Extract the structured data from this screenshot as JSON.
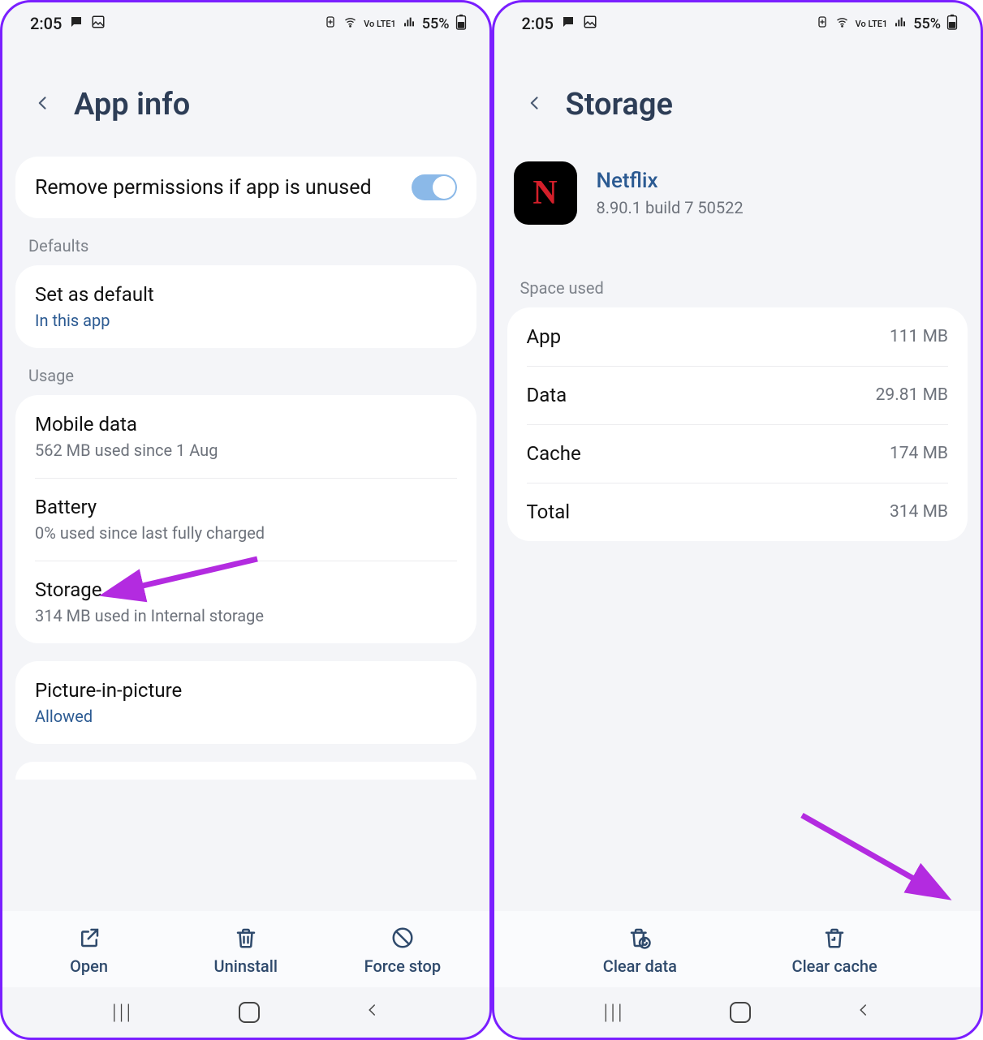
{
  "status": {
    "time": "2:05",
    "battery_pct": "55%",
    "net_label": "Vo LTE1"
  },
  "left": {
    "title": "App info",
    "permission_row": {
      "title": "Remove permissions if app is unused"
    },
    "sections": {
      "defaults_label": "Defaults",
      "usage_label": "Usage"
    },
    "default_row": {
      "title": "Set as default",
      "sub": "In this app"
    },
    "usage": {
      "mobile": {
        "title": "Mobile data",
        "sub": "562 MB used since 1 Aug"
      },
      "battery": {
        "title": "Battery",
        "sub": "0% used since last fully charged"
      },
      "storage": {
        "title": "Storage",
        "sub": "314 MB used in Internal storage"
      }
    },
    "pip": {
      "title": "Picture-in-picture",
      "sub": "Allowed"
    },
    "actions": {
      "open": "Open",
      "uninstall": "Uninstall",
      "force": "Force stop"
    }
  },
  "right": {
    "title": "Storage",
    "app": {
      "name": "Netflix",
      "version": "8.90.1 build 7 50522",
      "glyph": "N"
    },
    "space_label": "Space used",
    "rows": {
      "app": {
        "label": "App",
        "value": "111 MB"
      },
      "data": {
        "label": "Data",
        "value": "29.81 MB"
      },
      "cache": {
        "label": "Cache",
        "value": "174 MB"
      },
      "total": {
        "label": "Total",
        "value": "314 MB"
      }
    },
    "actions": {
      "clear_data": "Clear data",
      "clear_cache": "Clear cache"
    }
  }
}
